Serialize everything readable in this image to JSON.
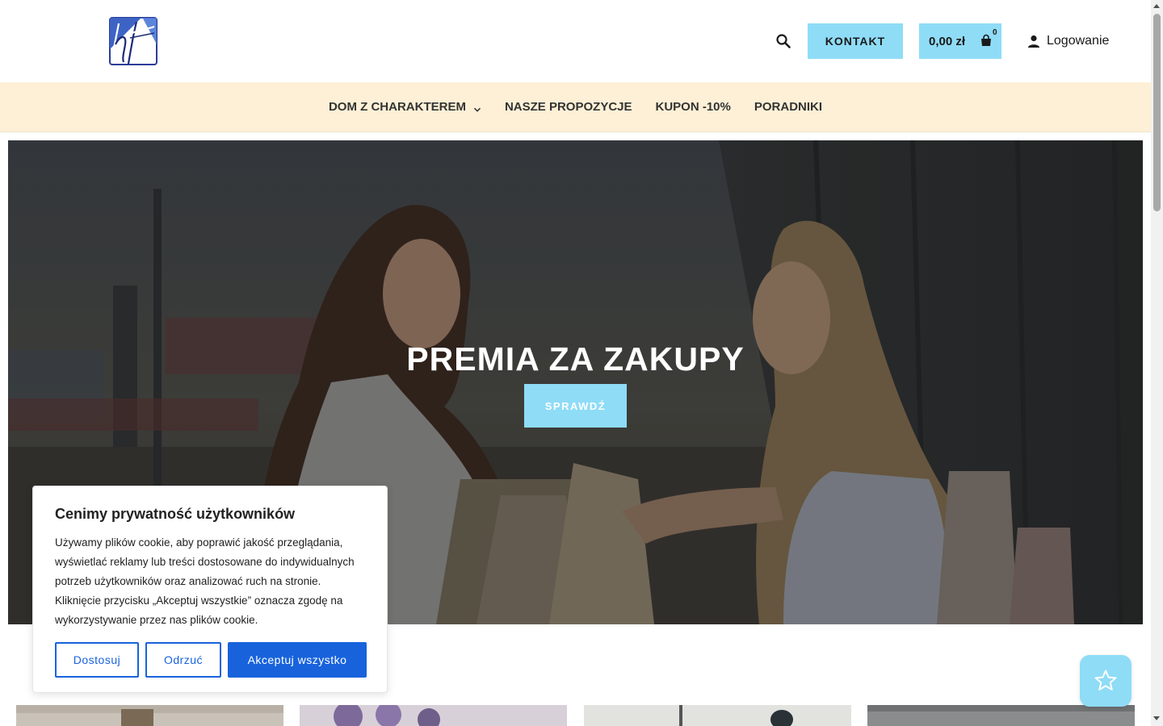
{
  "header": {
    "logo_text": "ht",
    "contact_label": "KONTAKT",
    "cart": {
      "price": "0,00 zł",
      "count": "0"
    },
    "login_label": "Logowanie"
  },
  "nav": {
    "items": [
      {
        "label": "DOM Z CHARAKTEREM",
        "has_dropdown": true
      },
      {
        "label": "NASZE PROPOZYCJE"
      },
      {
        "label": "KUPON -10%"
      },
      {
        "label": "PORADNIKI"
      }
    ]
  },
  "hero": {
    "title": "PREMIA ZA ZAKUPY",
    "button_label": "SPRAWDŹ"
  },
  "cookie_banner": {
    "title": "Cenimy prywatność użytkowników",
    "text": "Używamy plików cookie, aby poprawić jakość przeglądania, wyświetlać reklamy lub treści dostosowane do indywidualnych potrzeb użytkowników oraz analizować ruch na stronie. Kliknięcie przycisku „Akceptuj wszystkie” oznacza zgodę na wykorzystywanie przez nas plików cookie.",
    "customize_label": "Dostosuj",
    "reject_label": "Odrzuć",
    "accept_label": "Akceptuj wszystko"
  },
  "colors": {
    "accent": "#8fdcf7",
    "nav_bg": "#fdf0d6",
    "cookie_blue": "#1863dc",
    "logo_blue": "#2b3d9a"
  },
  "icons": [
    "search-icon",
    "bag-icon",
    "user-icon",
    "chevron-down-icon",
    "star-icon"
  ]
}
